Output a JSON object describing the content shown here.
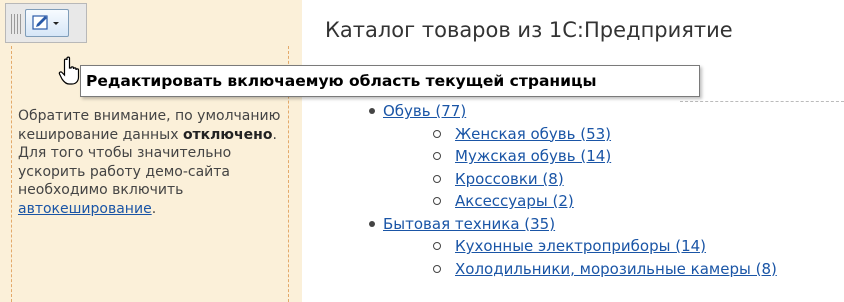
{
  "header": {
    "title": "Каталог товаров из 1С:Предприятие"
  },
  "toolbar": {
    "tooltip": "Редактировать включаемую область текущей страницы"
  },
  "sidebar": {
    "text_1": "Обратите внимание, по умолчанию кеширование данных ",
    "text_bold": "отключено",
    "text_2": ". Для того чтобы значительно ускорить работу демо-сайта необходимо включить ",
    "link": "автокеширование",
    "text_3": "."
  },
  "catalog": {
    "items": [
      {
        "label": "Обувь (77)",
        "level": 1
      },
      {
        "label": "Женская обувь (53)",
        "level": 2
      },
      {
        "label": "Мужская обувь (14)",
        "level": 2
      },
      {
        "label": "Кроссовки (8)",
        "level": 2
      },
      {
        "label": "Аксессуары (2)",
        "level": 2
      },
      {
        "label": "Бытовая техника (35)",
        "level": 1
      },
      {
        "label": "Кухонные электроприборы (14)",
        "level": 2
      },
      {
        "label": "Холодильники, морозильные камеры (8)",
        "level": 2
      }
    ]
  },
  "colors": {
    "link": "#1a55a6",
    "sidebar_bg": "#fbf0d9",
    "sidebar_border": "#e3a96a"
  }
}
